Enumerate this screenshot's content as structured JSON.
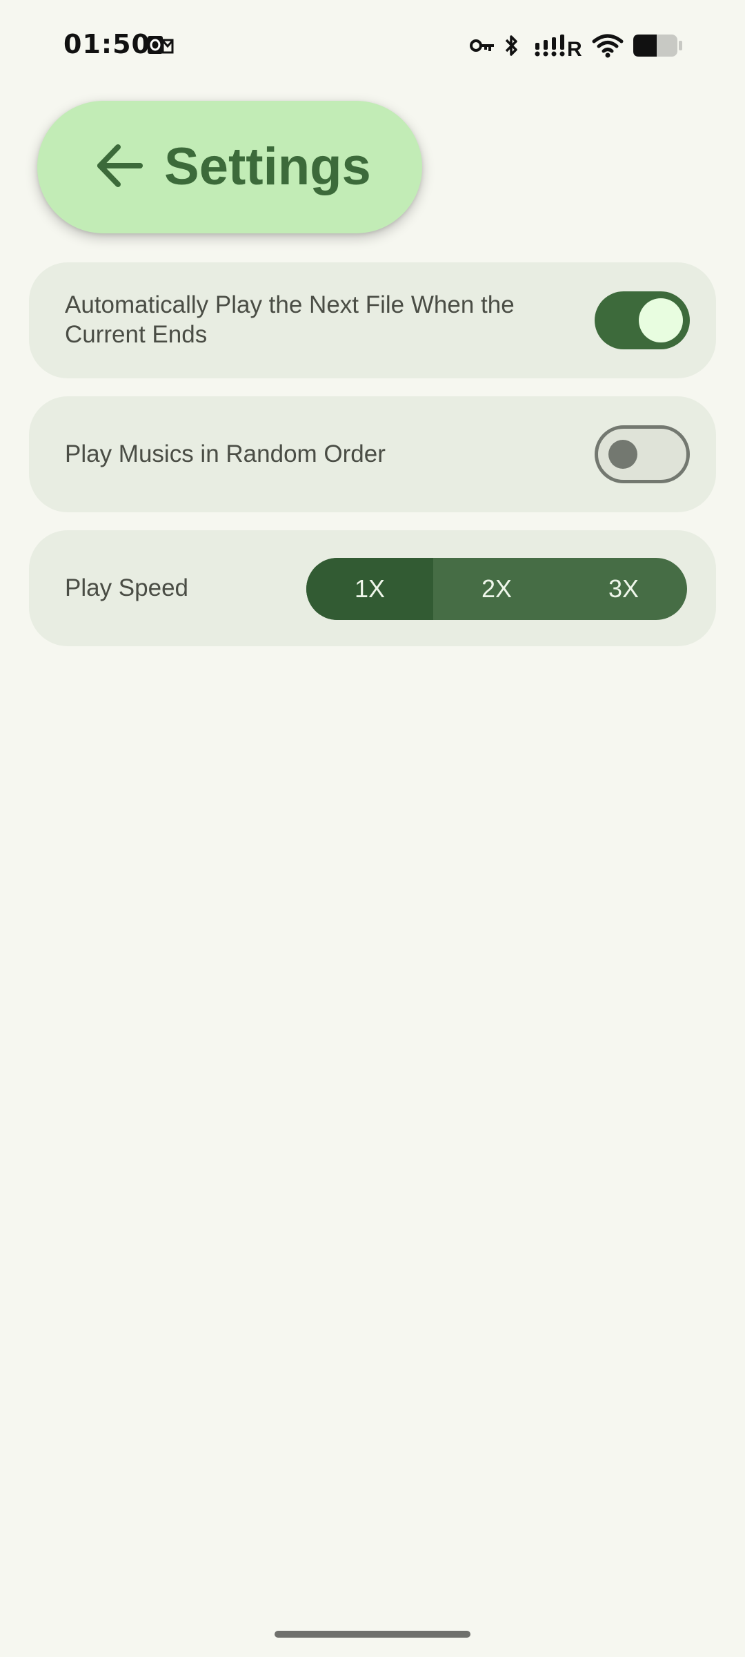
{
  "status_bar": {
    "time": "01:50",
    "icons": [
      "outlook-notification-icon",
      "vpn-key-icon",
      "bluetooth-icon",
      "signal-roaming-icon",
      "wifi-icon",
      "battery-icon"
    ]
  },
  "header": {
    "title": "Settings",
    "back_icon": "arrow-left-icon"
  },
  "settings": {
    "autoplay": {
      "label": "Automatically Play the Next File When the Current Ends",
      "enabled": true
    },
    "random_order": {
      "label": "Play Musics in Random Order",
      "enabled": false
    },
    "play_speed": {
      "label": "Play Speed",
      "options": [
        "1X",
        "2X",
        "3X"
      ],
      "selected": "1X"
    }
  },
  "colors": {
    "background": "#f6f7f0",
    "header_bg": "#c2ecb6",
    "accent": "#3d6a3b",
    "card_bg": "#e8ede2"
  }
}
